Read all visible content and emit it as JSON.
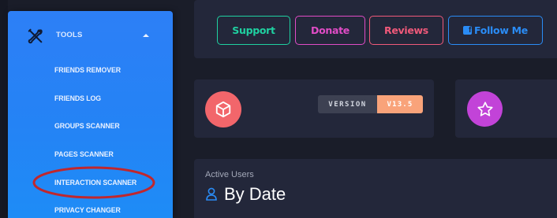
{
  "sidebar": {
    "header_label": "TOOLS",
    "items": [
      {
        "label": "FRIENDS REMOVER"
      },
      {
        "label": "FRIENDS LOG"
      },
      {
        "label": "GROUPS SCANNER"
      },
      {
        "label": "PAGES SCANNER"
      },
      {
        "label": "INTERACTION SCANNER"
      },
      {
        "label": "PRIVACY CHANGER"
      }
    ]
  },
  "header": {
    "buttons": {
      "support": "Support",
      "donate": "Donate",
      "reviews": "Reviews",
      "follow": "Follow Me"
    }
  },
  "version": {
    "label": "VERSION",
    "value": "V13.5"
  },
  "active_users": {
    "label": "Active Users",
    "title": "By Date"
  },
  "icons": {
    "tools": "tools-icon",
    "caret": "caret-up-icon",
    "facebook": "facebook-icon",
    "cube": "cube-icon",
    "star": "star-icon",
    "user": "user-icon"
  },
  "colors": {
    "sidebar": "#2d7ff6",
    "support": "#1fd1a1",
    "donate": "#e04cc6",
    "reviews": "#f0597a",
    "follow": "#2a8cf6",
    "version_value_bg": "#f9a37a",
    "cube_circle": "#f2666b",
    "star_circle": "#c243d8",
    "highlight": "#c0272d"
  }
}
